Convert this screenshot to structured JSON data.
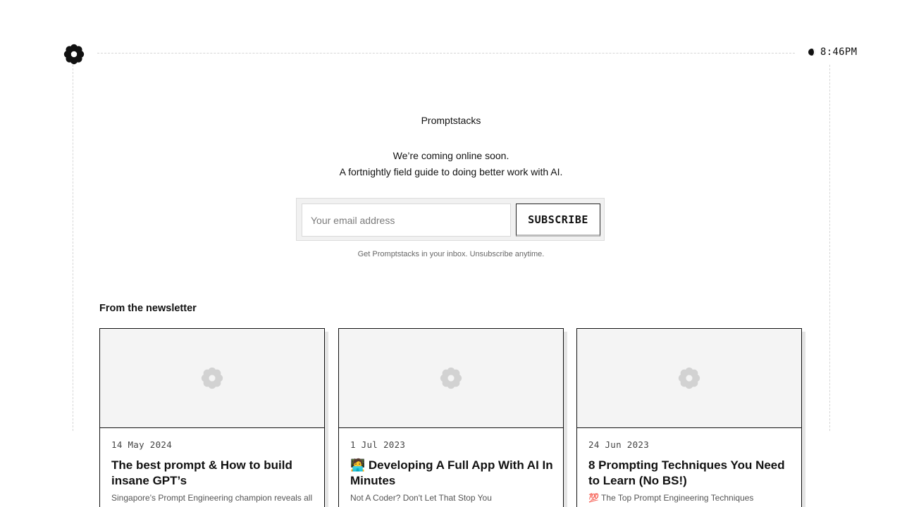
{
  "header": {
    "logo_icon": "flower-logo-icon",
    "clock_icon": "half-moon-icon",
    "time": "8:46PM"
  },
  "hero": {
    "brand": "Promptstacks",
    "tagline_line1": "We’re coming online soon.",
    "tagline_line2": "A fortnightly field guide to doing better work with AI."
  },
  "subscribe": {
    "email_placeholder": "Your email address",
    "button_label": "SUBSCRIBE",
    "note": "Get Promptstacks in your inbox. Unsubscribe anytime."
  },
  "newsletter": {
    "section_title": "From the newsletter",
    "posts": [
      {
        "date": "14 May 2024",
        "title": "The best prompt & How to build insane GPT’s",
        "subtitle": "Singapore's Prompt Engineering champion reveals all",
        "thumbnail_icon": "flower-placeholder-icon"
      },
      {
        "date": "1 Jul 2023",
        "title": "🧑‍💻 Developing A Full App With AI In Minutes",
        "subtitle": "Not A Coder? Don't Let That Stop You",
        "thumbnail_icon": "flower-placeholder-icon"
      },
      {
        "date": "24 Jun 2023",
        "title": "8 Prompting Techniques You Need to Learn (No BS!)",
        "subtitle": "💯 The Top Prompt Engineering Techniques",
        "thumbnail_icon": "flower-placeholder-icon"
      }
    ]
  },
  "colors": {
    "background": "#ffffff",
    "text": "#111111",
    "muted": "#555555",
    "thumb_bg": "#f4f4f4",
    "placeholder_icon": "#d0d0d0"
  }
}
